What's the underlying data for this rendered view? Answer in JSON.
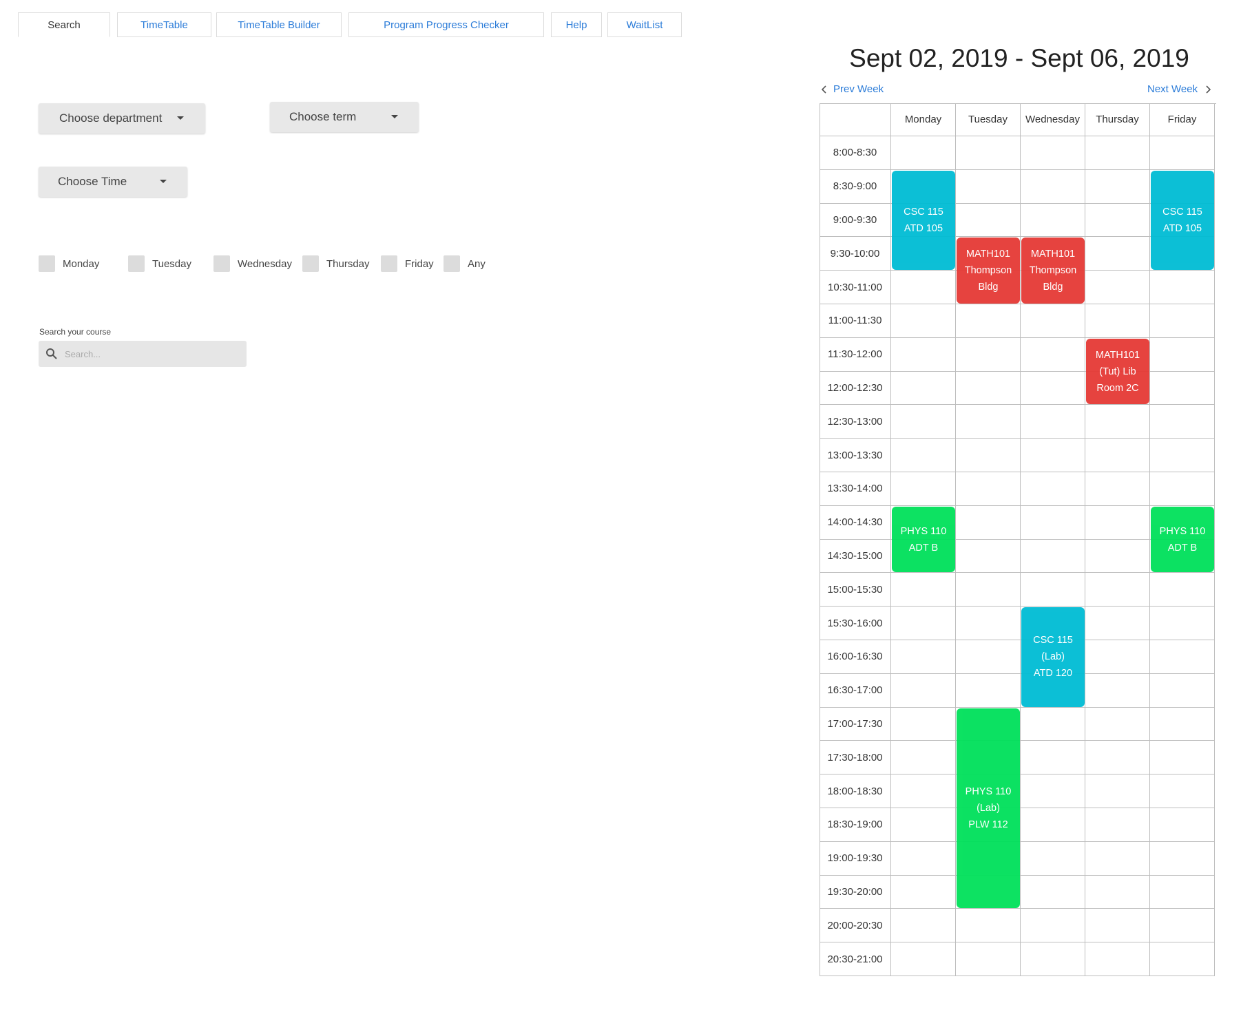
{
  "tabs": [
    "Search",
    "TimeTable",
    "TimeTable Builder",
    "Program Progress Checker",
    "Help",
    "WaitList"
  ],
  "filters": {
    "department": "Choose department",
    "term": "Choose term",
    "time": "Choose Time"
  },
  "days": [
    "Monday",
    "Tuesday",
    "Wednesday",
    "Thursday",
    "Friday",
    "Any"
  ],
  "search": {
    "label": "Search your course",
    "placeholder": "Search..."
  },
  "calendar": {
    "title": "Sept 02, 2019 - Sept 06, 2019",
    "prev": "Prev Week",
    "next": "Next Week",
    "columns": [
      "Monday",
      "Tuesday",
      "Wednesday",
      "Thursday",
      "Friday"
    ],
    "times": [
      "8:00-8:30",
      "8:30-9:00",
      "9:00-9:30",
      "9:30-10:00",
      "10:30-11:00",
      "11:00-11:30",
      "11:30-12:00",
      "12:00-12:30",
      "12:30-13:00",
      "13:00-13:30",
      "13:30-14:00",
      "14:00-14:30",
      "14:30-15:00",
      "15:00-15:30",
      "15:30-16:00",
      "16:00-16:30",
      "16:30-17:00",
      "17:00-17:30",
      "17:30-18:00",
      "18:00-18:30",
      "18:30-19:00",
      "19:00-19:30",
      "19:30-20:00",
      "20:00-20:30",
      "20:30-21:00"
    ],
    "events": [
      {
        "day": 0,
        "start": 1,
        "span": 3,
        "label": "CSC 115\nATD 105",
        "color": "#00bcd4"
      },
      {
        "day": 4,
        "start": 1,
        "span": 3,
        "label": "CSC 115\nATD 105",
        "color": "#00bcd4"
      },
      {
        "day": 1,
        "start": 3,
        "span": 2,
        "label": "MATH101\nThompson\nBldg",
        "color": "#e53935"
      },
      {
        "day": 2,
        "start": 3,
        "span": 2,
        "label": "MATH101\nThompson\nBldg",
        "color": "#e53935"
      },
      {
        "day": 3,
        "start": 6,
        "span": 2,
        "label": "MATH101\n(Tut) Lib\nRoom 2C",
        "color": "#e53935"
      },
      {
        "day": 0,
        "start": 11,
        "span": 2,
        "label": "PHYS 110\nADT B",
        "color": "#00e05a"
      },
      {
        "day": 4,
        "start": 11,
        "span": 2,
        "label": "PHYS 110\nADT B",
        "color": "#00e05a"
      },
      {
        "day": 2,
        "start": 14,
        "span": 3,
        "label": "CSC 115\n(Lab)\nATD 120",
        "color": "#00bcd4"
      },
      {
        "day": 1,
        "start": 17,
        "span": 6,
        "label": "PHYS 110\n(Lab)\nPLW 112",
        "color": "#00e05a"
      }
    ]
  }
}
